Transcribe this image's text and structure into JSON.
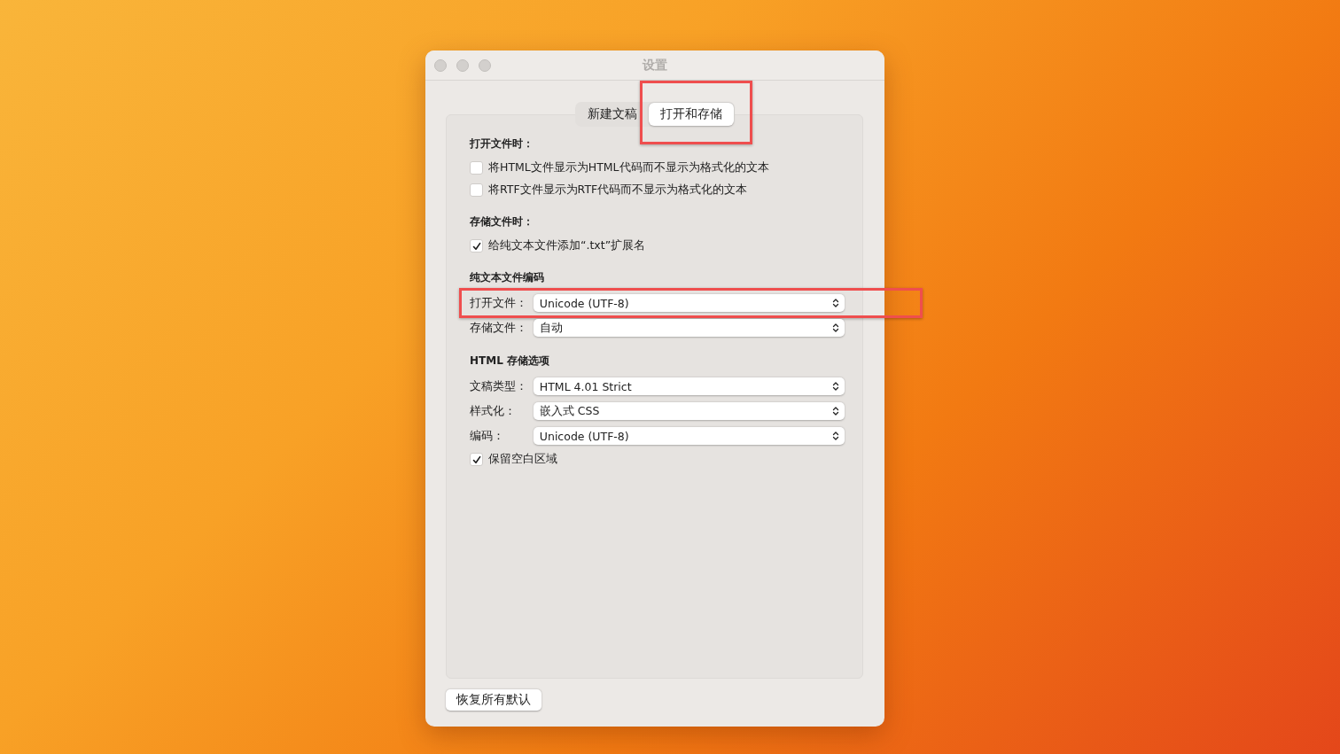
{
  "window": {
    "title": "设置"
  },
  "tabs": [
    {
      "label": "新建文稿",
      "selected": false,
      "highlighted": false
    },
    {
      "label": "打开和存储",
      "selected": true,
      "highlighted": true
    }
  ],
  "sections": [
    {
      "heading": "打开文件时：",
      "items": [
        {
          "kind": "checkbox",
          "label": "将HTML文件显示为HTML代码而不显示为格式化的文本",
          "checked": false
        },
        {
          "kind": "checkbox",
          "label": "将RTF文件显示为RTF代码而不显示为格式化的文本",
          "checked": false
        }
      ]
    },
    {
      "heading": "存储文件时：",
      "items": [
        {
          "kind": "checkbox",
          "label": "给纯文本文件添加“.txt”扩展名",
          "checked": true
        }
      ]
    },
    {
      "heading": "纯文本文件编码",
      "items": [
        {
          "kind": "select",
          "label": "打开文件：",
          "value": "Unicode (UTF-8)",
          "highlighted": true
        },
        {
          "kind": "select",
          "label": "存储文件：",
          "value": "自动",
          "highlighted": false
        }
      ]
    },
    {
      "heading": "HTML 存储选项",
      "items": [
        {
          "kind": "select",
          "label": "文稿类型：",
          "value": "HTML 4.01 Strict",
          "highlighted": false
        },
        {
          "kind": "select",
          "label": "样式化：",
          "value": "嵌入式 CSS",
          "highlighted": false
        },
        {
          "kind": "select",
          "label": "编码：",
          "value": "Unicode (UTF-8)",
          "highlighted": false
        },
        {
          "kind": "checkbox",
          "label": "保留空白区域",
          "checked": true
        }
      ]
    }
  ],
  "reset_button": "恢复所有默认"
}
